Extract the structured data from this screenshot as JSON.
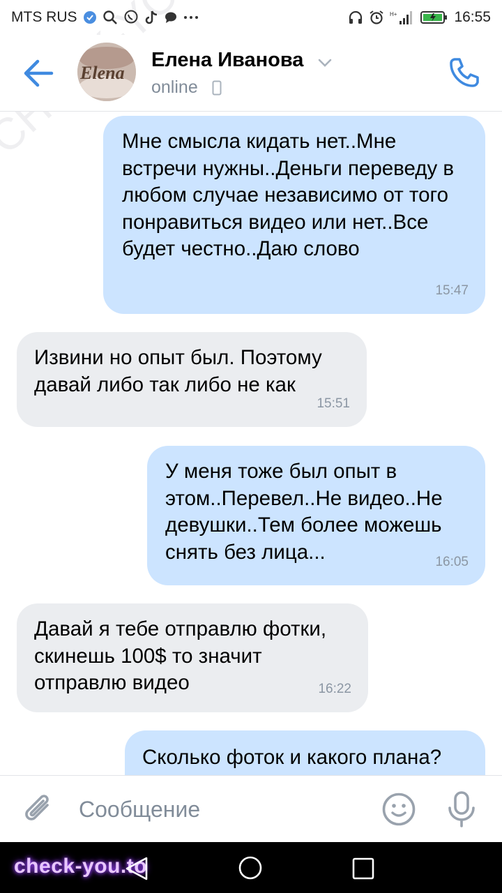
{
  "status_bar": {
    "carrier": "MTS RUS",
    "time": "16:55"
  },
  "header": {
    "contact_name": "Елена Иванова",
    "presence": "online",
    "avatar_text": "Elena"
  },
  "messages": [
    {
      "direction": "outgoing",
      "text": "Мне смысла кидать нет..Мне встречи нужны..Деньги переведу в любом случае независимо от того понравиться видео или нет..Все будет честно..Даю слово",
      "time": "15:47"
    },
    {
      "direction": "incoming",
      "text": "Извини но опыт был. Поэтому давай либо так либо не как",
      "time": "15:51"
    },
    {
      "direction": "outgoing",
      "text": "У меня тоже был опыт в этом..Перевел..Не видео..Не девушки..Тем более можешь снять без лица...",
      "time": "16:05"
    },
    {
      "direction": "incoming",
      "text": "Давай я тебе отправлю фотки, скинешь 100$ то значит отправлю видео",
      "time": "16:22"
    },
    {
      "direction": "outgoing",
      "text": "Сколько фоток и какого плана?",
      "time": ""
    }
  ],
  "composer": {
    "placeholder": "Сообщение"
  },
  "watermarks": {
    "site": "check-you.to",
    "diagonal": "CHECK-YOU.ME"
  },
  "colors": {
    "accent": "#3f8ae0",
    "outgoing_bubble": "#cce4ff",
    "incoming_bubble": "#ebedf0",
    "secondary_text": "#818c99"
  },
  "icons": {
    "back": "arrow-left-icon",
    "call": "phone-icon",
    "attach": "paperclip-icon",
    "emoji": "smile-icon",
    "mic": "microphone-icon"
  }
}
